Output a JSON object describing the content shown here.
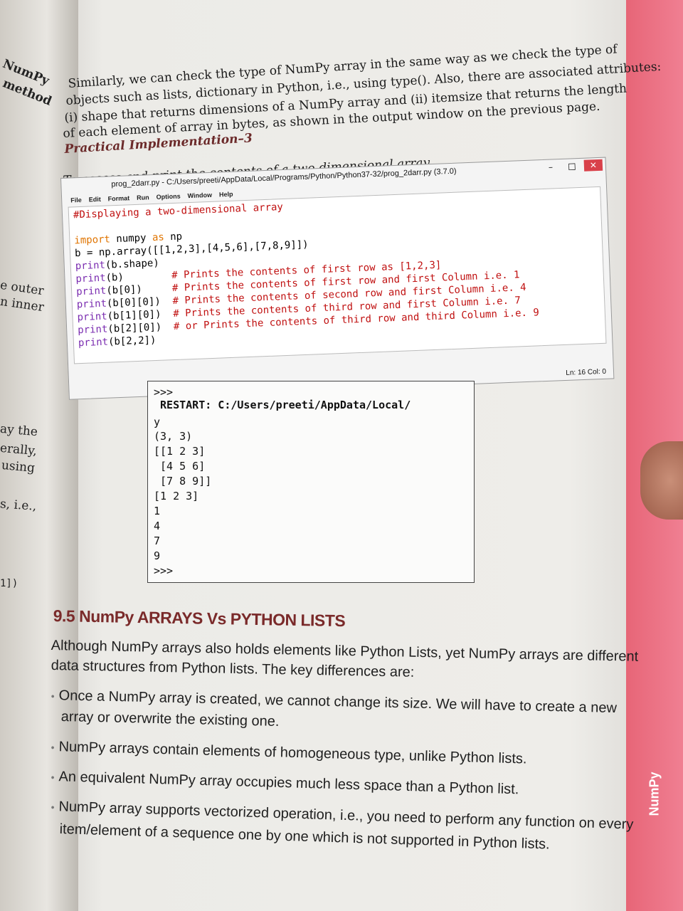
{
  "left_page": {
    "lines": [
      "NumPy",
      "method",
      "e outer",
      "n inner",
      "ay the",
      "erally,",
      "using",
      "s, i.e.,",
      "1])"
    ]
  },
  "intro": {
    "lines": [
      "Similarly, we can check the type of NumPy array in the same way as we check the type of",
      "objects such as lists, dictionary in Python, i.e., using type(). Also, there are associated attributes:",
      "(i) shape that returns dimensions of a NumPy array and (ii) itemsize that returns the length",
      "of each element of array in bytes, as shown in the output window on the previous page."
    ]
  },
  "practical": {
    "heading": "Practical Implementation–3",
    "task": "To access and print the contents of a two-dimensional array."
  },
  "editor": {
    "title": "prog_2darr.py - C:/Users/preeti/AppData/Local/Programs/Python/Python37-32/prog_2darr.py (3.7.0)",
    "minimize": "–",
    "maximize": "□",
    "close": "✕",
    "menu": [
      "File",
      "Edit",
      "Format",
      "Run",
      "Options",
      "Window",
      "Help"
    ],
    "code": [
      "#Displaying a two-dimensional array",
      "",
      "import numpy as np",
      "b = np.array([[1,2,3],[4,5,6],[7,8,9]])",
      "print(b.shape)",
      "print(b)        # Prints the contents of first row as [1,2,3]",
      "print(b[0])     # Prints the contents of first row and first Column i.e. 1",
      "print(b[0][0])  # Prints the contents of second row and first Column i.e. 4",
      "print(b[1][0])  # Prints the contents of third row and first Column i.e. 7",
      "print(b[2][0])  # or Prints the contents of third row and third Column i.e. 9",
      "print(b[2,2])"
    ],
    "status": "Ln: 16  Col: 0"
  },
  "shell": {
    "lines": [
      ">>>",
      " RESTART: C:/Users/preeti/AppData/Local/",
      "y",
      "(3, 3)",
      "[[1 2 3]",
      " [4 5 6]",
      " [7 8 9]]",
      "[1 2 3]",
      "1",
      "4",
      "7",
      "9",
      ">>>"
    ]
  },
  "section": {
    "title": "9.5 NumPy ARRAYS Vs PYTHON LISTS",
    "intro_lines": [
      "Although NumPy arrays also holds elements like Python Lists, yet NumPy arrays are different",
      "data structures from Python lists. The key differences are:"
    ],
    "bullets": [
      [
        "Once a NumPy array is created, we cannot change its size. We will have to create a new",
        "array or overwrite the existing one."
      ],
      [
        "NumPy arrays contain elements of homogeneous type, unlike Python lists."
      ],
      [
        "An equivalent NumPy array occupies much less space than a Python list."
      ],
      [
        "NumPy array supports vectorized operation, i.e., you need to perform any function on every",
        "item/element of a sequence one by one which is not supported in Python lists."
      ]
    ]
  },
  "side_tab": "NumPy"
}
